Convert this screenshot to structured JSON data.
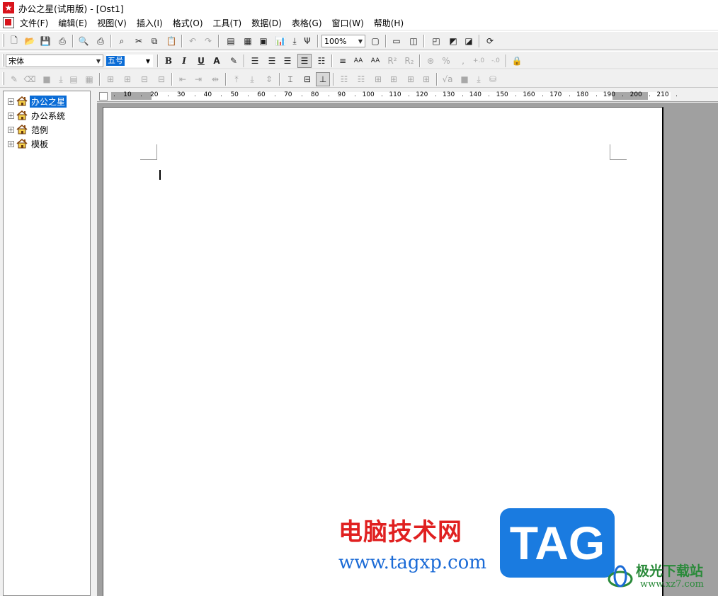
{
  "window": {
    "title": "办公之星(试用版) - [Ost1]"
  },
  "menu": [
    {
      "label": "文件(F)"
    },
    {
      "label": "编辑(E)"
    },
    {
      "label": "视图(V)"
    },
    {
      "label": "插入(I)"
    },
    {
      "label": "格式(O)"
    },
    {
      "label": "工具(T)"
    },
    {
      "label": "数据(D)"
    },
    {
      "label": "表格(G)"
    },
    {
      "label": "窗口(W)"
    },
    {
      "label": "帮助(H)"
    }
  ],
  "toolbar": {
    "zoom": "100%",
    "font_name": "宋体",
    "font_size": "五号"
  },
  "tree": [
    {
      "label": "办公之星",
      "selected": true
    },
    {
      "label": "办公系统",
      "selected": false
    },
    {
      "label": "范例",
      "selected": false
    },
    {
      "label": "模板",
      "selected": false
    }
  ],
  "ruler": {
    "labels": [
      "10",
      "20",
      "30",
      "40",
      "50",
      "60",
      "70",
      "80",
      "90",
      "100",
      "110",
      "120",
      "130",
      "140",
      "150",
      "160",
      "170",
      "180",
      "190",
      "200",
      "210"
    ]
  },
  "watermark": {
    "site_name": "电脑技术网",
    "url": "www.tagxp.com",
    "tag": "TAG",
    "jg_name": "极光下载站",
    "jg_url": "www.xz7.com"
  },
  "colors": {
    "selection": "#0a6cd6",
    "brand_red": "#d8141c",
    "workspace": "#a0a0a0"
  }
}
